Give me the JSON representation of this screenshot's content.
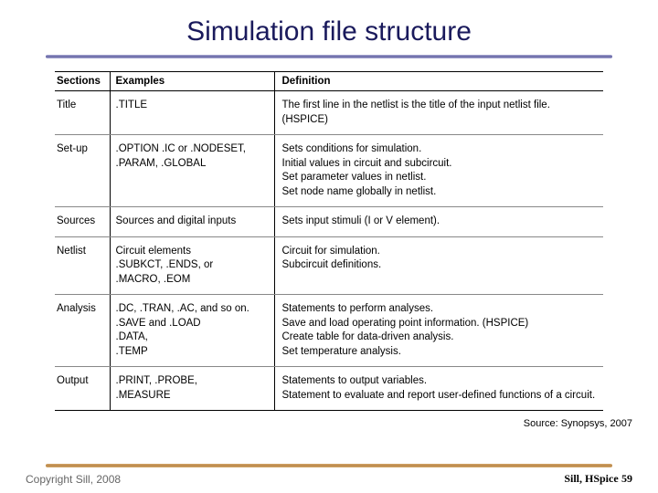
{
  "title": "Simulation file structure",
  "table": {
    "headers": [
      "Sections",
      "Examples",
      "Definition"
    ],
    "rows": [
      {
        "section": "Title",
        "examples": ".TITLE",
        "definition": "The first line in the netlist is the title of the input netlist file. (HSPICE)"
      },
      {
        "section": "Set-up",
        "examples": ".OPTION .IC or .NODESET,\n.PARAM, .GLOBAL",
        "definition": "Sets conditions for simulation.\nInitial values in circuit and subcircuit.\nSet parameter values in netlist.\nSet node name globally in netlist."
      },
      {
        "section": "Sources",
        "examples": "Sources and digital inputs",
        "definition": "Sets input stimuli (I or V element)."
      },
      {
        "section": "Netlist",
        "examples": "Circuit elements\n.SUBKCT, .ENDS, or\n.MACRO, .EOM",
        "definition": "Circuit for simulation.\nSubcircuit definitions."
      },
      {
        "section": "Analysis",
        "examples": ".DC, .TRAN, .AC, and so on.\n.SAVE and .LOAD\n.DATA,\n.TEMP",
        "definition": "Statements to perform analyses.\nSave and load operating point information. (HSPICE)\nCreate table for data-driven analysis.\nSet temperature analysis."
      },
      {
        "section": "Output",
        "examples": ".PRINT, .PROBE,\n.MEASURE",
        "definition": "Statements to output variables.\nStatement to evaluate and report user-defined functions of a circuit."
      }
    ]
  },
  "source": "Source: Synopsys, 2007",
  "copyright": "Copyright Sill, 2008",
  "footer": {
    "label": "Sill, HSpice",
    "page": "59"
  }
}
